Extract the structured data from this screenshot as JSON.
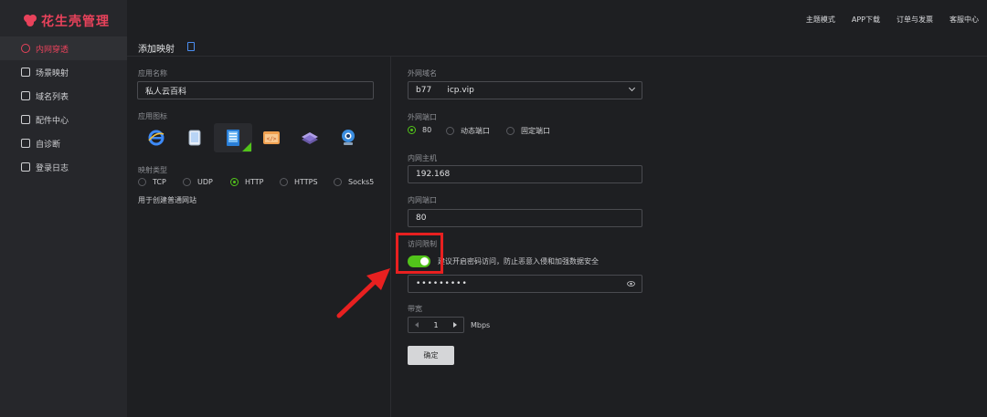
{
  "app": {
    "logo_text": "花生壳管理"
  },
  "topnav": [
    "主题模式",
    "APP下载",
    "订单与发票",
    "客服中心"
  ],
  "sidebar": {
    "items": [
      {
        "label": "内网穿透",
        "icon": "penetrate-icon",
        "active": true
      },
      {
        "label": "场景映射",
        "icon": "scene-icon"
      },
      {
        "label": "域名列表",
        "icon": "domain-icon"
      },
      {
        "label": "配件中心",
        "icon": "grid-icon"
      },
      {
        "label": "自诊断",
        "icon": "diagnose-icon"
      },
      {
        "label": "登录日志",
        "icon": "log-icon"
      }
    ]
  },
  "page": {
    "title": "添加映射"
  },
  "left": {
    "app_name_label": "应用名称",
    "app_name_value": "私人云百科",
    "app_icon_label": "应用图标",
    "map_type_label": "映射类型",
    "map_types": [
      "TCP",
      "UDP",
      "HTTP",
      "HTTPS",
      "Socks5"
    ],
    "map_type_selected": "HTTP",
    "hint": "用于创建普通网站"
  },
  "right": {
    "ext_domain_label": "外网域名",
    "ext_domain_value": "b77      icp.vip",
    "ext_port_label": "外网端口",
    "ext_port_options": [
      "80",
      "动态端口",
      "固定端口"
    ],
    "ext_port_selected": "80",
    "int_host_label": "内网主机",
    "int_host_value": "192.168",
    "int_port_label": "内网端口",
    "int_port_value": "80",
    "access_label": "访问限制",
    "access_desc": "建议开启密码访问，防止恶意入侵和加强数据安全",
    "password_value": "•••••••••",
    "bandwidth_label": "带宽",
    "bandwidth_value": "1",
    "bandwidth_unit": "Mbps",
    "confirm_label": "确定"
  },
  "colors": {
    "brand": "#e8425b",
    "switch_on": "#52c41a",
    "annotation": "#e82020"
  }
}
